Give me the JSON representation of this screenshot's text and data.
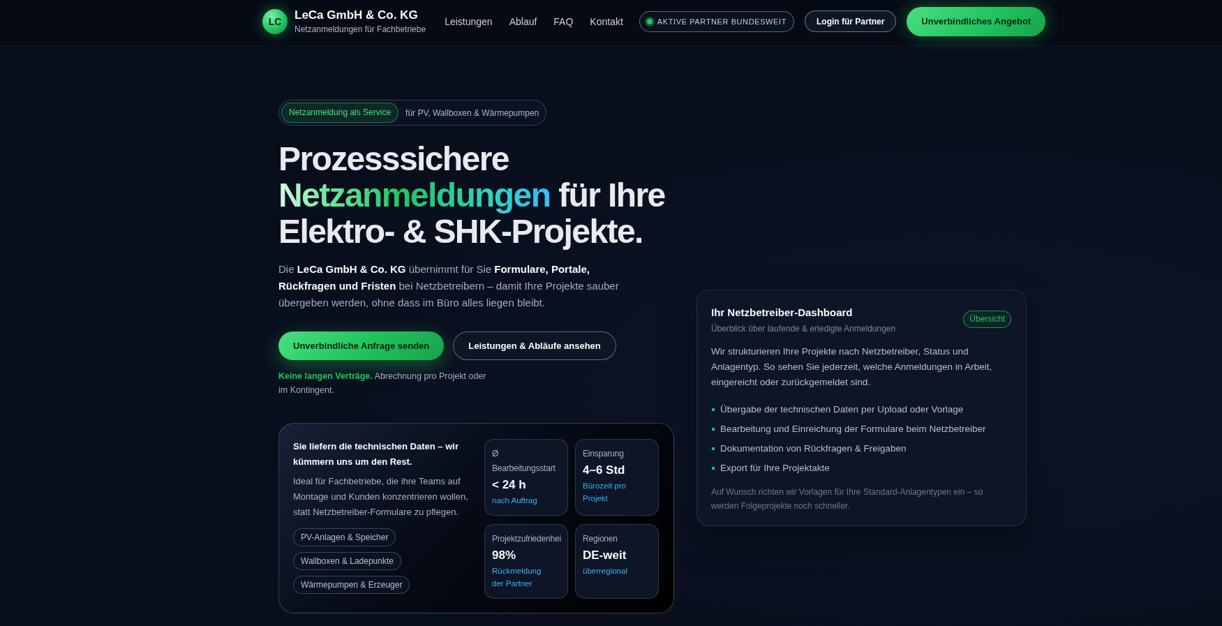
{
  "header": {
    "logo": "LC",
    "brand_name": "LeCa GmbH & Co. KG",
    "brand_tagline": "Netzanmeldungen für Fachbetriebe",
    "nav": [
      "Leistungen",
      "Ablauf",
      "FAQ",
      "Kontakt"
    ],
    "status_badge": "AKTIVE PARTNER BUNDESWEIT",
    "buttons": [
      {
        "label": "Login für Partner",
        "kind": "outline"
      },
      {
        "label": "Unverbindliches Angebot",
        "kind": "primary"
      }
    ]
  },
  "hero": {
    "eyebrow_tag": "Netzanmeldung als Service",
    "eyebrow_text": "für PV, Wallboxen & Wärmepumpen",
    "headline": {
      "lead": "Prozesssichere",
      "highlight": "Netzanmeldungen",
      "rest": "für Ihre Elektro- & SHK-Projekte."
    },
    "intro": "Die **LeCa GmbH & Co. KG** übernimmt für Sie **Formulare, Portale, Rückfragen und Fristen** bei Netzbetreibern – damit Ihre Projekte sauber übergeben werden, ohne dass im Büro alles liegen bleibt.",
    "actions": [
      {
        "label": "Unverbindliche Anfrage senden",
        "kind": "primary"
      },
      {
        "label": "Leistungen & Abläufe ansehen",
        "kind": "outline"
      }
    ],
    "note": "**Keine langen Verträge.** Abrechnung pro Projekt oder im Kontingent."
  },
  "service_card": {
    "title": "Sie liefern die technischen Daten – wir kümmern uns um den Rest.",
    "text": "Ideal für Fachbetriebe, die ihre Teams auf Montage und Kunden konzentrieren wollen, statt Netzbetreiber-Formulare zu pflegen.",
    "tags": [
      "PV-Anlagen & Speicher",
      "Wallboxen & Ladepunkte",
      "Wärmepumpen & Erzeuger"
    ],
    "stats": [
      {
        "label": "Ø Bearbeitungsstart",
        "value": "< 24 h",
        "detail": "nach Auftrag"
      },
      {
        "label": "Einsparung",
        "value": "4–6 Std",
        "detail": "Bürozeit pro Projekt"
      },
      {
        "label": "Projektzufriedenhei",
        "value": "98%",
        "detail": "Rückmeldung der Partner"
      },
      {
        "label": "Regionen",
        "value": "DE-weit",
        "detail": "überregional"
      }
    ]
  },
  "dashboard_card": {
    "title": "Ihr Netzbetreiber-Dashboard",
    "subtitle": "Überblick über laufende & erledigte Anmeldungen",
    "badge": "Übersicht",
    "text": "Wir strukturieren Ihre Projekte nach Netzbetreiber, Status und Anlagentyp. So sehen Sie jederzeit, welche Anmeldungen in Arbeit, eingereicht oder zurückgemeldet sind.",
    "items": [
      "Übergabe der technischen Daten per Upload oder Vorlage",
      "Bearbeitung und Einreichung der Formulare beim Netzbetreiber",
      "Dokumentation von Rückfragen & Freigaben",
      "Export für Ihre Projektakte"
    ],
    "footnote": "Auf Wunsch richten wir Vorlagen für Ihre Standard-Anlagentypen ein – so werden Folgeprojekte noch schneller."
  }
}
